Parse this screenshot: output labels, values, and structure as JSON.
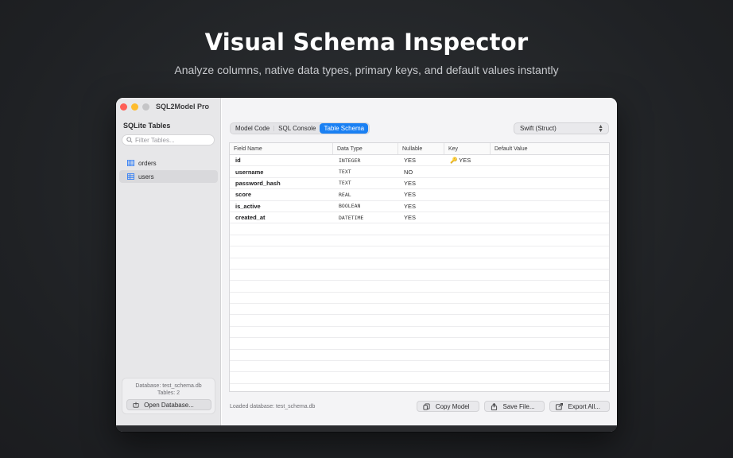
{
  "hero": {
    "title": "Visual Schema Inspector",
    "subtitle": "Analyze columns, native data types, primary keys, and default values instantly"
  },
  "app": {
    "name": "SQL2Model Pro"
  },
  "sidebar": {
    "title": "SQLite Tables",
    "search_placeholder": "Filter Tables...",
    "tables": [
      {
        "label": "orders",
        "selected": false
      },
      {
        "label": "users",
        "selected": true
      }
    ],
    "db_info": {
      "database_line": "Database: test_schema.db",
      "tables_line": "Tables: 2",
      "open_button": "Open Database..."
    }
  },
  "toolbar": {
    "tabs": [
      "Model Code",
      "SQL Console",
      "Table Schema"
    ],
    "active_tab": "Table Schema",
    "language_select": "Swift (Struct)",
    "accent_color": "#1a80f3"
  },
  "schema": {
    "headers": [
      "Field Name",
      "Data Type",
      "Nullable",
      "Key",
      "Default Value"
    ],
    "rows": [
      {
        "field": "id",
        "type": "INTEGER",
        "nullable": "YES",
        "key": "🔑 YES",
        "default": ""
      },
      {
        "field": "username",
        "type": "TEXT",
        "nullable": "NO",
        "key": "",
        "default": ""
      },
      {
        "field": "password_hash",
        "type": "TEXT",
        "nullable": "YES",
        "key": "",
        "default": ""
      },
      {
        "field": "score",
        "type": "REAL",
        "nullable": "YES",
        "key": "",
        "default": ""
      },
      {
        "field": "is_active",
        "type": "BOOLEAN",
        "nullable": "YES",
        "key": "",
        "default": ""
      },
      {
        "field": "created_at",
        "type": "DATETIME",
        "nullable": "YES",
        "key": "",
        "default": ""
      }
    ]
  },
  "footer": {
    "status": "Loaded database: test_schema.db",
    "copy_button": "Copy Model",
    "save_button": "Save File...",
    "export_button": "Export All..."
  }
}
